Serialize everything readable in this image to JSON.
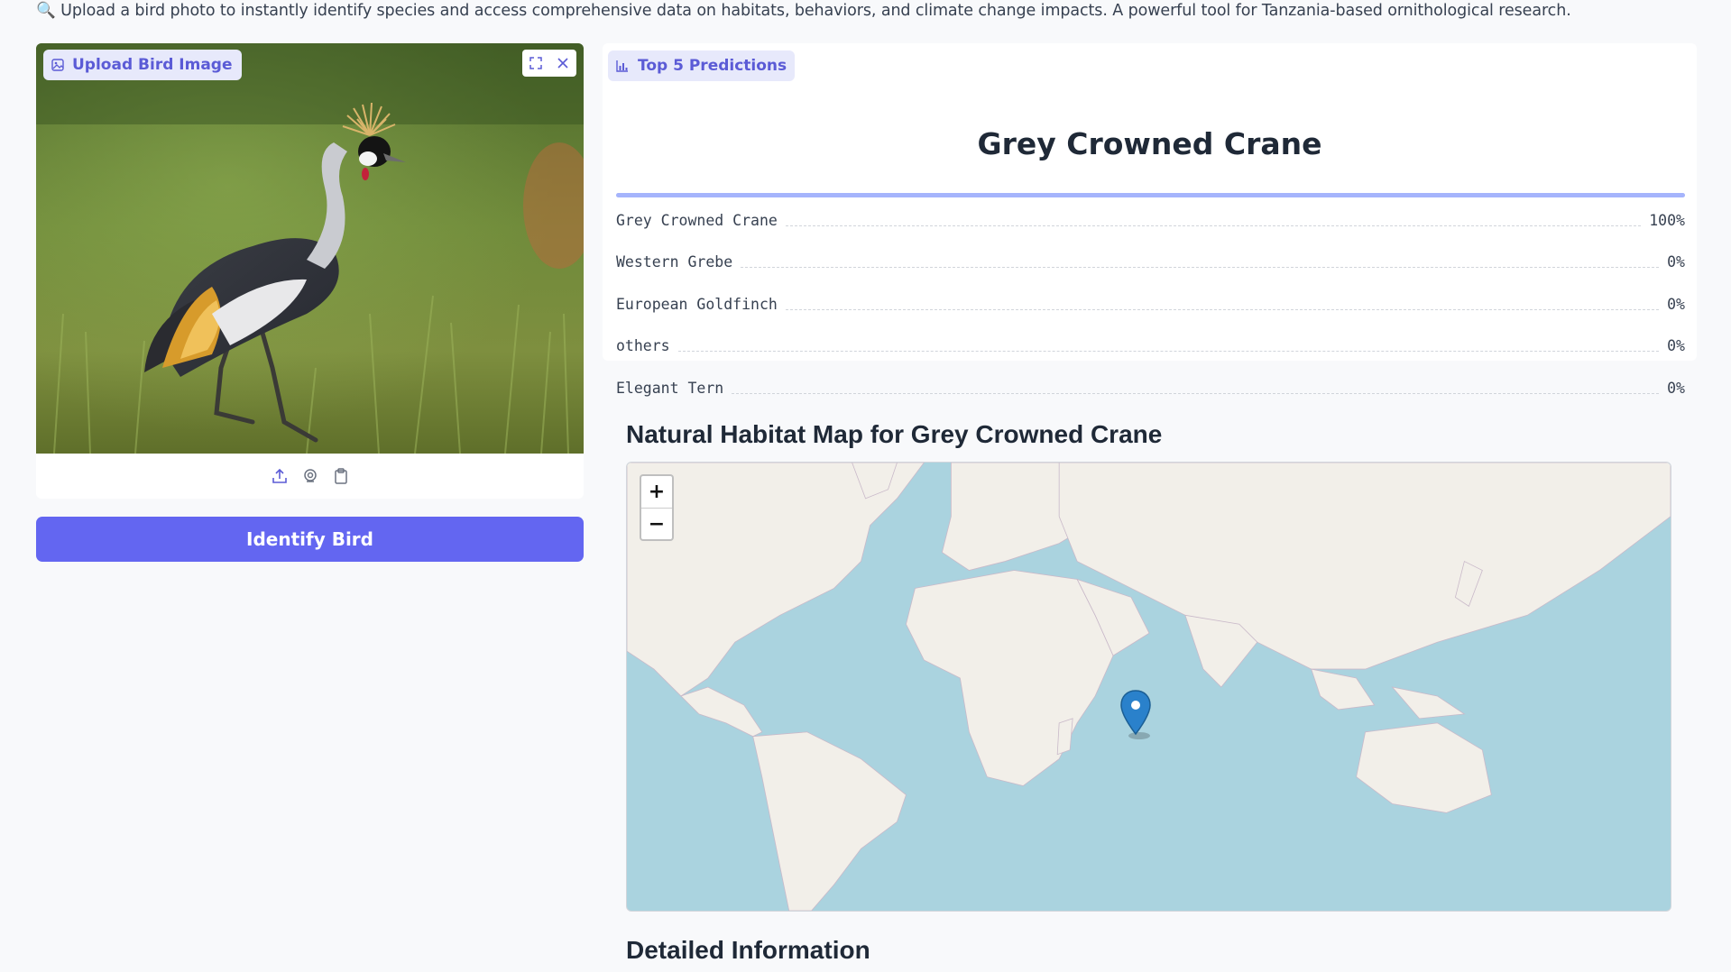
{
  "intro": {
    "icon": "magnifier-icon",
    "text": "🔍 Upload a bird photo to instantly identify species and access comprehensive data on habitats, behaviors, and climate change impacts. A powerful tool for Tanzania-based ornithological research."
  },
  "upload": {
    "label": "Upload Bird Image",
    "label_icon": "image-icon",
    "actions": [
      "fullscreen-icon",
      "close-icon"
    ],
    "sources": [
      "upload-icon",
      "webcam-icon",
      "clipboard-icon"
    ]
  },
  "identify_button": "Identify Bird",
  "predictions": {
    "label": "Top 5 Predictions",
    "label_icon": "bar-chart-icon",
    "top_label": "Grey Crowned Crane",
    "top_confidence": 1.0,
    "items": [
      {
        "name": "Grey Crowned Crane",
        "pct": "100%"
      },
      {
        "name": "Western Grebe",
        "pct": "0%"
      },
      {
        "name": "European Goldfinch",
        "pct": "0%"
      },
      {
        "name": "others",
        "pct": "0%"
      },
      {
        "name": "Elegant Tern",
        "pct": "0%"
      }
    ]
  },
  "map": {
    "heading": "Natural Habitat Map for Grey Crowned Crane",
    "zoom_in": "+",
    "zoom_out": "−",
    "marker_icon": "map-pin-icon"
  },
  "details": {
    "heading": "Detailed Information"
  },
  "colors": {
    "accent": "#6366f1",
    "chip_bg": "#e7e9fb",
    "chip_text": "#5b5bd6",
    "ocean": "#aad3df",
    "land": "#f2efe9",
    "marker": "#2a81cb"
  }
}
